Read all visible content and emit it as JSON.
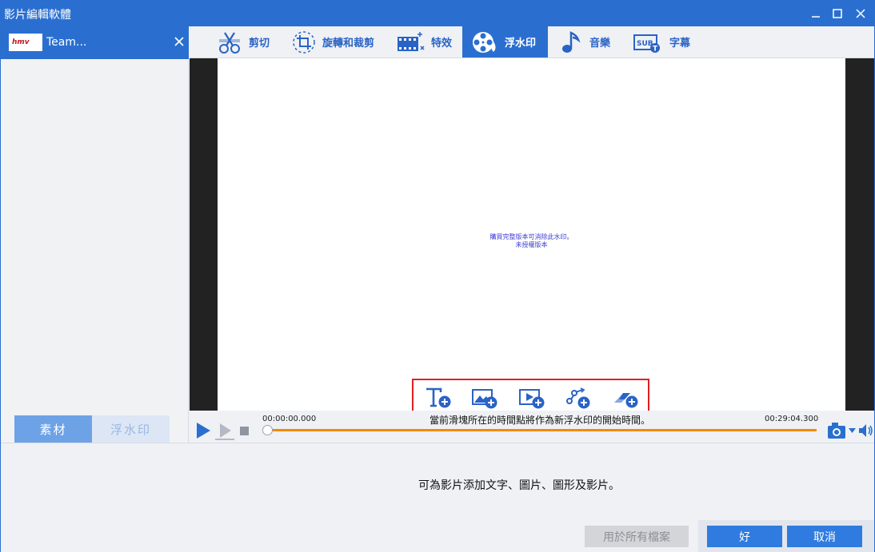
{
  "window": {
    "title": "影片編輯軟體"
  },
  "file": {
    "thumbnail_text": "hmv",
    "name": "Team..."
  },
  "left_tabs": {
    "materials": "素材",
    "watermark": "浮水印"
  },
  "toolbar": {
    "cut": "剪切",
    "rotate_crop": "旋轉和裁剪",
    "effects": "特效",
    "watermark": "浮水印",
    "music": "音樂",
    "subtitle": "字幕",
    "active": "watermark"
  },
  "preview": {
    "watermark_line1": "購買完整版本可消除此水印。",
    "watermark_line2": "未授權版本"
  },
  "player": {
    "current_time": "00:00:00.000",
    "total_time": "00:29:04.300",
    "hint": "當前滑塊所在的時間點將作為新浮水印的開始時間。",
    "progress": 0.0
  },
  "description": "可為影片添加文字、圖片、圖形及影片。",
  "buttons": {
    "apply_all": "用於所有檔案",
    "ok": "好",
    "cancel": "取消"
  },
  "colors": {
    "accent": "#2a6fd0",
    "progress": "#f28a00",
    "highlight_border": "#e02020"
  }
}
